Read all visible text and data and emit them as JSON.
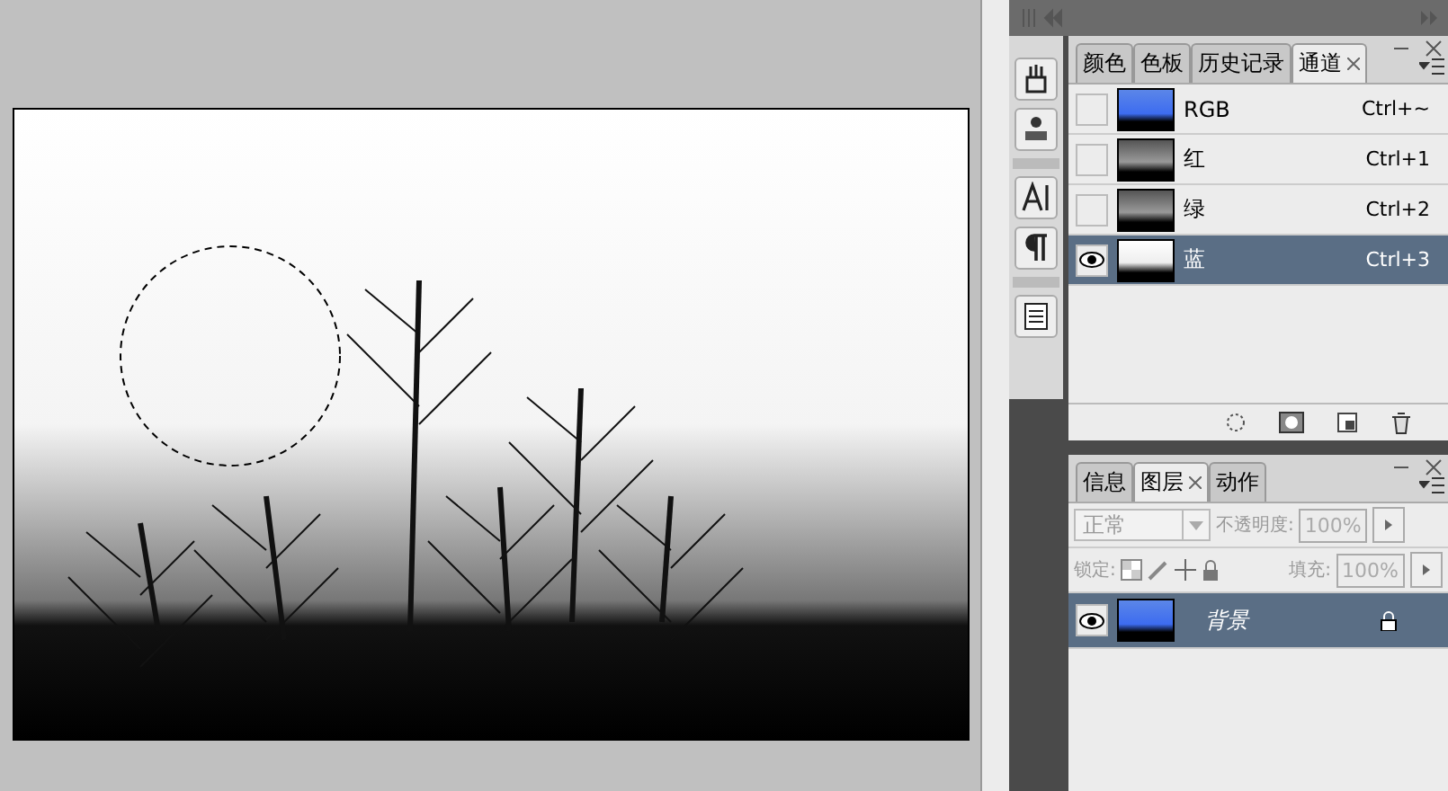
{
  "channels_panel": {
    "tabs": [
      {
        "label": "颜色",
        "selected": false
      },
      {
        "label": "色板",
        "selected": false
      },
      {
        "label": "历史记录",
        "selected": false
      },
      {
        "label": "通道",
        "selected": true
      }
    ],
    "channels": [
      {
        "name": "RGB",
        "shortcut": "Ctrl+~",
        "kind": "color",
        "visible": false,
        "selected": false
      },
      {
        "name": "红",
        "shortcut": "Ctrl+1",
        "kind": "dark",
        "visible": false,
        "selected": false
      },
      {
        "name": "绿",
        "shortcut": "Ctrl+2",
        "kind": "dark",
        "visible": false,
        "selected": false
      },
      {
        "name": "蓝",
        "shortcut": "Ctrl+3",
        "kind": "light",
        "visible": true,
        "selected": true
      }
    ]
  },
  "layers_panel": {
    "tabs": [
      {
        "label": "信息",
        "selected": false
      },
      {
        "label": "图层",
        "selected": true
      },
      {
        "label": "动作",
        "selected": false
      }
    ],
    "blend_mode": "正常",
    "opacity_label": "不透明度:",
    "opacity": "100%",
    "lock_label": "锁定:",
    "fill_label": "填充:",
    "fill": "100%",
    "layers": [
      {
        "name": "背景",
        "visible": true,
        "selected": true,
        "locked": true
      }
    ]
  }
}
